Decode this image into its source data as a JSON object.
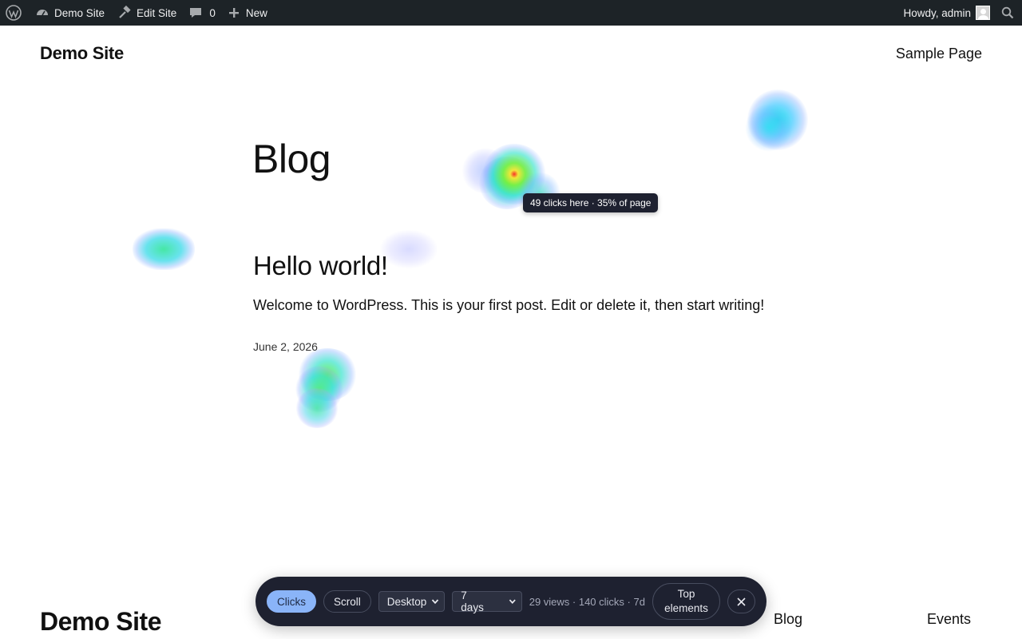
{
  "adminbar": {
    "site_name": "Demo Site",
    "edit_site": "Edit Site",
    "comments_count": "0",
    "new_label": "New",
    "greeting": "Howdy, admin"
  },
  "header": {
    "site_title": "Demo Site",
    "nav_item": "Sample Page"
  },
  "main": {
    "blog_title": "Blog",
    "post": {
      "title": "Hello world!",
      "excerpt": "Welcome to WordPress. This is your first post. Edit or delete it, then start writing!",
      "date": "June 2, 2026"
    }
  },
  "heatmap": {
    "tooltip": "49 clicks here · 35% of page"
  },
  "footer": {
    "site_title": "Demo Site",
    "links": [
      "Blog",
      "Events"
    ]
  },
  "toolbar": {
    "modes": [
      "Clicks",
      "Scroll"
    ],
    "active_mode": "Clicks",
    "device": "Desktop",
    "range": "7 days",
    "stats": "29 views · 140 clicks · 7d",
    "top_elements_line1": "Top",
    "top_elements_line2": "elements"
  },
  "colors": {
    "adminbar_bg": "#1d2327",
    "toolbar_bg": "#1e2130",
    "active_pill": "#8ab4f8"
  },
  "icons": [
    "wordpress-icon",
    "dashboard-icon",
    "hammer-icon",
    "comment-icon",
    "plus-icon",
    "avatar",
    "search-icon",
    "chevron-down-icon",
    "close-icon"
  ]
}
